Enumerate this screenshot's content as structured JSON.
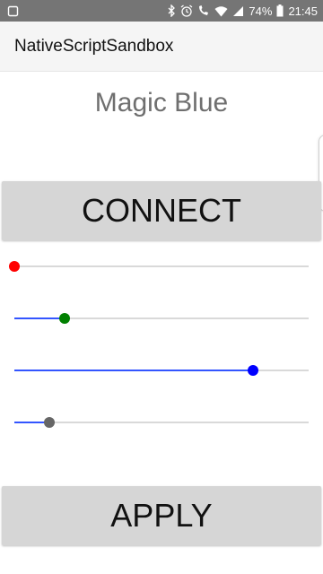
{
  "status_bar": {
    "battery_percent": "74%",
    "time": "21:45",
    "icons": [
      "notification-icon",
      "bluetooth-icon",
      "alarm-icon",
      "wifi-calling-icon",
      "wifi-icon",
      "signal-icon",
      "battery-icon"
    ]
  },
  "action_bar": {
    "title": "NativeScriptSandbox"
  },
  "device": {
    "name": "Magic Blue"
  },
  "buttons": {
    "connect_label": "CONNECT",
    "apply_label": "APPLY"
  },
  "sliders": [
    {
      "name": "slider-red",
      "value": 0.0,
      "thumb_color": "#ff0000",
      "fill_color": "#3355ff"
    },
    {
      "name": "slider-green",
      "value": 0.17,
      "thumb_color": "#008000",
      "fill_color": "#3355ff"
    },
    {
      "name": "slider-blue",
      "value": 0.81,
      "thumb_color": "#0000ff",
      "fill_color": "#3355ff"
    },
    {
      "name": "slider-gray",
      "value": 0.12,
      "thumb_color": "#666666",
      "fill_color": "#3355ff"
    }
  ],
  "colors": {
    "status_bar_bg": "#757575",
    "action_bar_bg": "#f5f5f5",
    "button_bg": "#d6d6d6",
    "track_color": "#d9d9d9",
    "accent": "#3355ff"
  }
}
